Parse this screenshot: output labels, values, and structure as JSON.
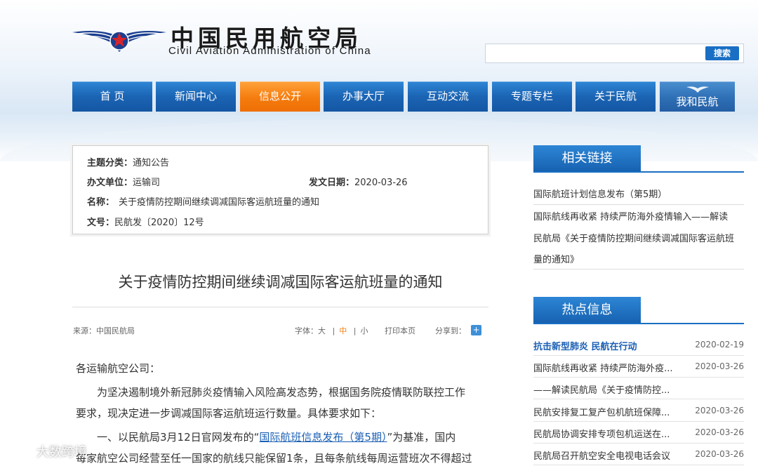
{
  "header": {
    "title_cn": "中国民用航空局",
    "title_en": "Civil Aviation Administration of China",
    "search_placeholder": "",
    "search_button": "搜索"
  },
  "nav": {
    "items": [
      {
        "label": "首 页"
      },
      {
        "label": "新闻中心"
      },
      {
        "label": "信息公开"
      },
      {
        "label": "办事大厅"
      },
      {
        "label": "互动交流"
      },
      {
        "label": "专题专栏"
      },
      {
        "label": "关于民航"
      },
      {
        "label": "我和民航"
      }
    ],
    "active_color": "#f57c0e",
    "base_color": "#1b64b4"
  },
  "info": {
    "category_label": "主题分类：",
    "category_value": "通知公告",
    "unit_label": "办文单位：",
    "unit_value": "运输司",
    "date_label": "发文日期：",
    "date_value": "2020-03-26",
    "name_label": "名称：",
    "name_value": "关于疫情防控期间继续调减国际客运航班量的通知",
    "doc_label": "文号：",
    "doc_value": "民航发〔2020〕12号"
  },
  "article": {
    "title": "关于疫情防控期间继续调减国际客运航班量的通知",
    "source": "来源：中国民航局",
    "font_label": "字体：",
    "font_large": "大",
    "font_medium": "中",
    "font_small": "小",
    "bar": "|",
    "print": "打印本页",
    "share": "分享到：",
    "salutation": "各运输航空公司：",
    "p1_line1": "为坚决遏制境外新冠肺炎疫情输入风险高发态势，根据国务院疫情联防联控工作",
    "p1_line2": "要求，现决定进一步调减国际客运航班运行数量。具体要求如下：",
    "p2_prefix": "一、以民航局3月12日官网发布的“",
    "p2_link": "国际航班信息发布（第5期）",
    "p2_suffix": "”为基准，国内",
    "p2_line2": "每家航空公司经营至任一国家的航线只能保留1条，且每条航线每周运营班次不得超过"
  },
  "sidebar": {
    "related_title": "相关链接",
    "related": [
      "国际航班计划信息发布（第5期）",
      "国际航线再收紧 持续严防海外疫情输入——解读",
      "民航局《关于疫情防控期间继续调减国际客运航班",
      "量的通知》"
    ],
    "hot_title": "热点信息",
    "hot": [
      {
        "title": "抗击新型肺炎 民航在行动",
        "date": "2020-02-19"
      },
      {
        "title": "国际航线再收紧 持续严防海外疫...",
        "date": "2020-03-26"
      },
      {
        "title": "——解读民航局《关于疫情防控...",
        "date": ""
      },
      {
        "title": "民航安排复工复产包机航班保障...",
        "date": "2020-03-26"
      },
      {
        "title": "民航局协调安排专项包机运送在...",
        "date": "2020-03-26"
      },
      {
        "title": "民航局召开航空安全电视电话会议",
        "date": "2020-03-26"
      }
    ]
  },
  "watermark": "大数跨境"
}
